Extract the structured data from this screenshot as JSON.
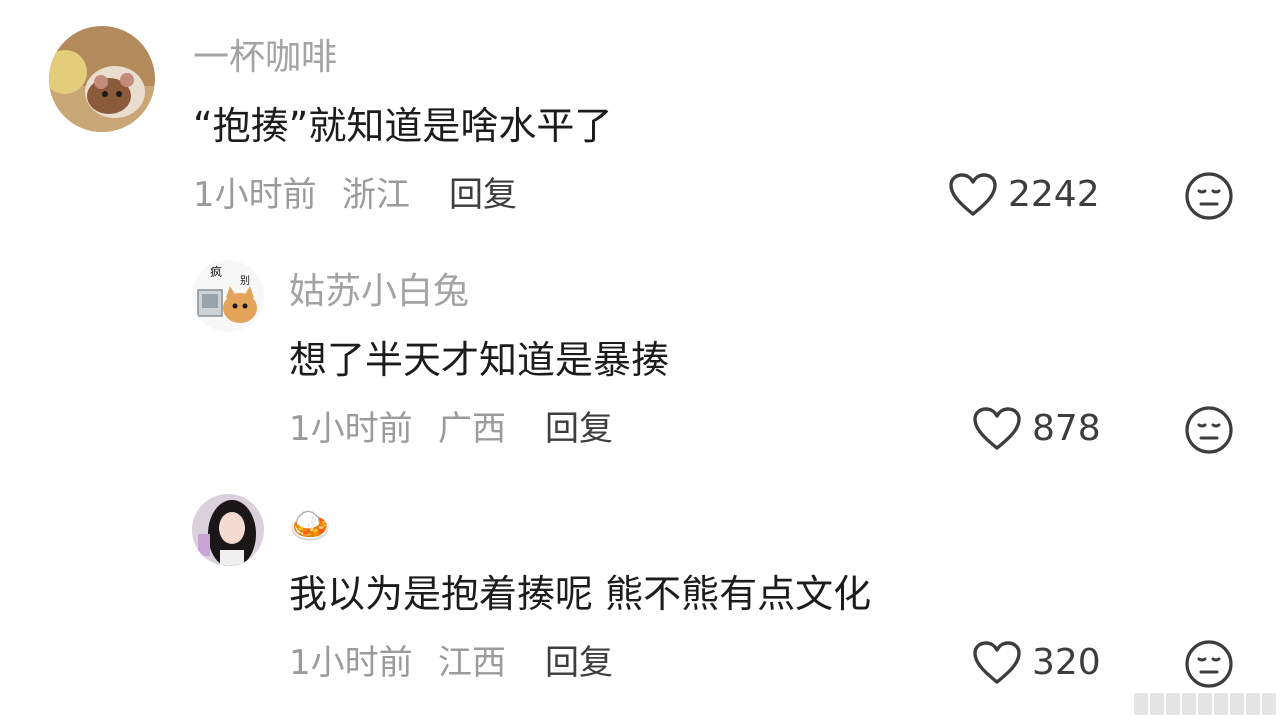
{
  "comments": [
    {
      "username": "一杯咖啡",
      "text": "“抱揍”就知道是啥水平了",
      "time": "1小时前",
      "location": "浙江",
      "reply_label": "回复",
      "likes": "2242"
    },
    {
      "username": "姑苏小白兔",
      "text": "想了半天才知道是暴揍",
      "time": "1小时前",
      "location": "广西",
      "reply_label": "回复",
      "likes": "878",
      "avatar_text": [
        "疯",
        "别"
      ]
    },
    {
      "username": "🍛",
      "text": "我以为是抱着揍呢 熊不熊有点文化",
      "time": "1小时前",
      "location": "江西",
      "reply_label": "回复",
      "likes": "320"
    }
  ],
  "icons": {
    "like": "heart-outline-icon",
    "dislike": "meh-face-icon"
  },
  "colors": {
    "text_primary": "#1c1c1c",
    "text_secondary": "#9b9b9b",
    "username": "#a3a3a3",
    "icon": "#3d3d3d"
  }
}
